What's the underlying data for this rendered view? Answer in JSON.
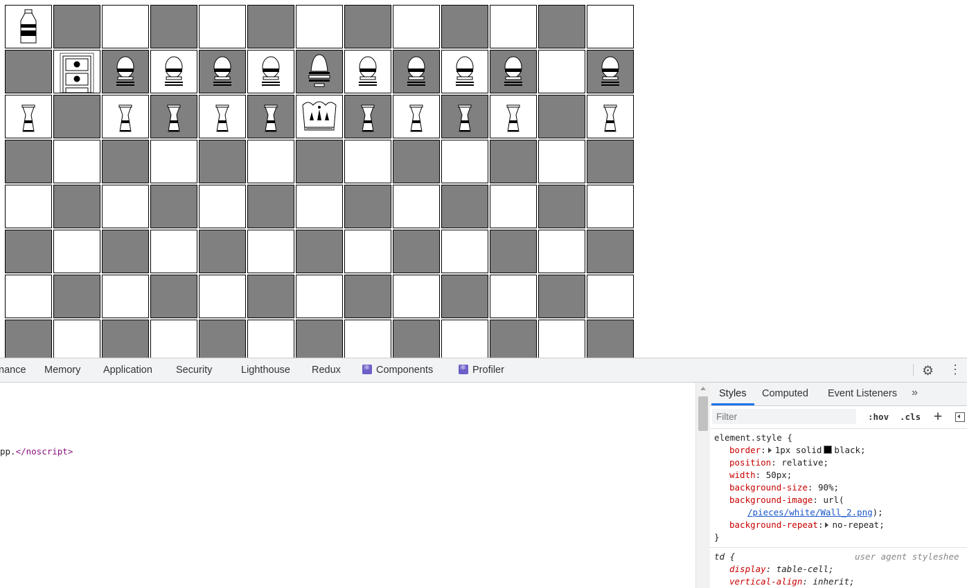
{
  "board": {
    "columns": 13,
    "rows": [
      [
        "bottle",
        null,
        null,
        null,
        null,
        null,
        null,
        null,
        null,
        null,
        null,
        null,
        null
      ],
      [
        null,
        "wall",
        "egg",
        "egg",
        "egg",
        "egg",
        "tall-egg",
        "egg",
        "egg",
        "egg",
        "egg",
        null,
        "egg"
      ],
      [
        "vase",
        null,
        "vase",
        "vase",
        "vase",
        "vase",
        "crown",
        "vase",
        "vase",
        "vase",
        "vase",
        null,
        "vase"
      ],
      [
        null,
        null,
        null,
        null,
        null,
        null,
        null,
        null,
        null,
        null,
        null,
        null,
        null
      ],
      [
        null,
        null,
        null,
        null,
        null,
        null,
        null,
        null,
        null,
        null,
        null,
        null,
        null
      ],
      [
        null,
        null,
        null,
        null,
        null,
        null,
        null,
        null,
        null,
        null,
        null,
        null,
        null
      ],
      [
        null,
        null,
        null,
        null,
        null,
        null,
        null,
        null,
        null,
        null,
        null,
        null,
        null
      ],
      [
        null,
        null,
        null,
        null,
        null,
        null,
        null,
        null,
        null,
        null,
        null,
        null,
        null
      ]
    ],
    "colors": {
      "light": "#ffffff",
      "dark": "#808080"
    }
  },
  "devtools": {
    "tabs": [
      "nance",
      "Memory",
      "Application",
      "Security",
      "Lighthouse",
      "Redux",
      "Components",
      "Profiler"
    ],
    "settings_icon": "gear-icon",
    "more_icon": "kebab-icon",
    "elements": {
      "noscript_prefix": "pp.",
      "noscript_close": "</noscript>"
    },
    "styles_panel": {
      "tabs": [
        "Styles",
        "Computed",
        "Event Listeners"
      ],
      "more": "»",
      "filter_placeholder": "Filter",
      "hov": ":hov",
      "cls": ".cls",
      "add": "+",
      "element_style": {
        "selector": "element.style {",
        "border_prop": "border",
        "border_val_pre": "1px solid",
        "border_val_color": "black;",
        "position_prop": "position",
        "position_val": "relative;",
        "width_prop": "width",
        "width_val": "50px;",
        "bgsize_prop": "background-size",
        "bgsize_val": "90%;",
        "bgimage_prop": "background-image",
        "bgimage_val": "url(",
        "bgimage_link": "/pieces/white/Wall_2.png",
        "bgimage_close": ");",
        "bgrepeat_prop": "background-repeat",
        "bgrepeat_val": "no-repeat;",
        "close": "}"
      },
      "td_rule": {
        "selector": "td {",
        "source": "user agent styleshee",
        "display_prop": "display",
        "display_val": "table-cell;",
        "valign_prop": "vertical-align",
        "valign_val": "inherit;"
      }
    }
  }
}
